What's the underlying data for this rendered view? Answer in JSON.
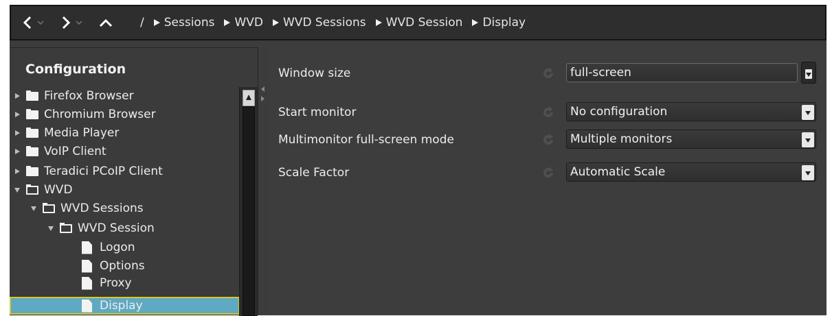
{
  "breadcrumb": {
    "root": "/",
    "items": [
      "Sessions",
      "WVD",
      "WVD Sessions",
      "WVD Session",
      "Display"
    ]
  },
  "nav": {
    "back_icon": "chevron-left-icon",
    "forward_icon": "chevron-right-icon",
    "up_icon": "chevron-up-icon"
  },
  "sidebar": {
    "title": "Configuration",
    "items": [
      {
        "label": "Firefox Browser",
        "icon": "folder-icon"
      },
      {
        "label": "Chromium Browser",
        "icon": "folder-icon"
      },
      {
        "label": "Media Player",
        "icon": "folder-icon"
      },
      {
        "label": "VoIP Client",
        "icon": "folder-icon"
      },
      {
        "label": "Teradici PCoIP Client",
        "icon": "folder-icon"
      },
      {
        "label": "WVD",
        "icon": "folder-open-icon"
      },
      {
        "label": "WVD Sessions",
        "icon": "folder-open-icon"
      },
      {
        "label": "WVD Session",
        "icon": "folder-open-icon"
      },
      {
        "label": "Logon",
        "icon": "document-icon"
      },
      {
        "label": "Options",
        "icon": "document-icon"
      },
      {
        "label": "Proxy",
        "icon": "document-icon"
      },
      {
        "label": "Display",
        "icon": "document-icon"
      }
    ],
    "selected": "Display"
  },
  "properties": [
    {
      "label": "Window size",
      "value": "full-screen"
    },
    {
      "label": "Start monitor",
      "value": "No configuration"
    },
    {
      "label": "Multimonitor full-screen mode",
      "value": "Multiple monitors"
    },
    {
      "label": "Scale Factor",
      "value": "Automatic Scale"
    }
  ],
  "colors": {
    "selection": "#5fa9c2",
    "selection_outline": "#d6c92c",
    "background": "#3c3c3c"
  }
}
